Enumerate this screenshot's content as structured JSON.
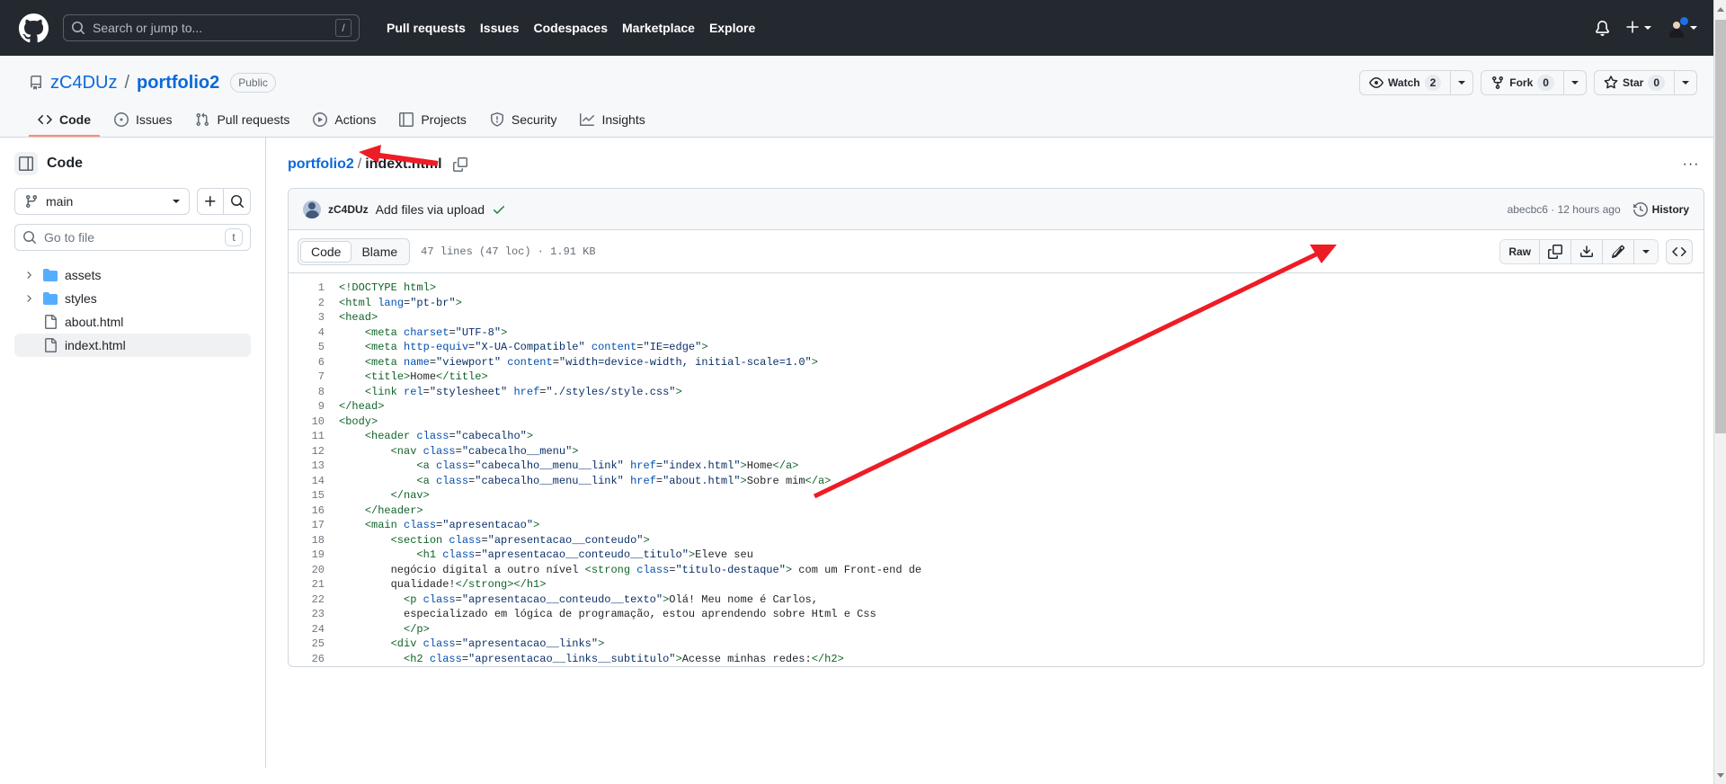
{
  "header": {
    "logo_icon": "github-mark-icon",
    "search": {
      "placeholder": "Search or jump to...",
      "shortcut": "/",
      "icon": "search-icon"
    },
    "nav": [
      {
        "label": "Pull requests"
      },
      {
        "label": "Issues"
      },
      {
        "label": "Codespaces"
      },
      {
        "label": "Marketplace"
      },
      {
        "label": "Explore"
      }
    ],
    "notifications_icon": "bell-icon",
    "create_new_icon": "plus-icon",
    "account_icon": "avatar-icon"
  },
  "repo": {
    "icon": "repo-icon",
    "owner": "zC4DUz",
    "separator": "/",
    "name": "portfolio2",
    "visibility": "Public",
    "actions": [
      {
        "name": "watch",
        "icon": "eye-icon",
        "label": "Watch",
        "count": "2"
      },
      {
        "name": "fork",
        "icon": "fork-icon",
        "label": "Fork",
        "count": "0"
      },
      {
        "name": "star",
        "icon": "star-icon",
        "label": "Star",
        "count": "0"
      }
    ],
    "tabs": [
      {
        "label": "Code",
        "icon": "code-icon",
        "active": true
      },
      {
        "label": "Issues",
        "icon": "issue-opened-icon",
        "active": false
      },
      {
        "label": "Pull requests",
        "icon": "git-pull-request-icon",
        "active": false
      },
      {
        "label": "Actions",
        "icon": "play-icon",
        "active": false
      },
      {
        "label": "Projects",
        "icon": "table-icon",
        "active": false
      },
      {
        "label": "Security",
        "icon": "shield-icon",
        "active": false
      },
      {
        "label": "Insights",
        "icon": "graph-icon",
        "active": false
      }
    ]
  },
  "sidebar": {
    "title": "Code",
    "toggle_icon": "sidebar-collapse-icon",
    "branch": {
      "icon": "git-branch-icon",
      "name": "main"
    },
    "add_file_icon": "plus-icon",
    "search_icon": "search-icon",
    "file_filter": {
      "placeholder": "Go to file",
      "value": "",
      "icon": "search-icon",
      "shortcut": "t"
    },
    "tree": [
      {
        "type": "folder",
        "label": "assets",
        "expanded": false,
        "selected": false
      },
      {
        "type": "folder",
        "label": "styles",
        "expanded": false,
        "selected": false
      },
      {
        "type": "file",
        "label": "about.html",
        "selected": false
      },
      {
        "type": "file",
        "label": "indext.html",
        "selected": true
      }
    ]
  },
  "main": {
    "breadcrumb": {
      "repo": "portfolio2",
      "separator": "/",
      "file": "indext.html",
      "copy_icon": "copy-icon"
    },
    "more_options_label": "···",
    "commit": {
      "author": "zC4DUz",
      "message": "Add files via upload",
      "status_icon": "check-icon",
      "hash_and_time": "abecbc6 · 12 hours ago",
      "history_label": "History",
      "history_icon": "history-icon"
    },
    "toolbar": {
      "tabs": [
        {
          "label": "Code",
          "active": true
        },
        {
          "label": "Blame",
          "active": false
        }
      ],
      "file_meta": "47 lines (47 loc) · 1.91 KB",
      "raw_label": "Raw",
      "copy_icon": "copy-icon",
      "download_icon": "download-icon",
      "edit_icon": "pencil-icon",
      "edit_dropdown_icon": "chevron-down-icon",
      "symbols_icon": "code-brackets-icon"
    },
    "code": {
      "language": "html",
      "lines": [
        {
          "n": 1,
          "tokens": [
            {
              "t": "tg",
              "v": "<!DOCTYPE html>"
            }
          ]
        },
        {
          "n": 2,
          "tokens": [
            {
              "t": "tg",
              "v": "<html "
            },
            {
              "t": "at",
              "v": "lang"
            },
            {
              "t": "pu",
              "v": "="
            },
            {
              "t": "st",
              "v": "\"pt-br\""
            },
            {
              "t": "tg",
              "v": ">"
            }
          ]
        },
        {
          "n": 3,
          "tokens": [
            {
              "t": "tg",
              "v": "<head>"
            }
          ]
        },
        {
          "n": 4,
          "tokens": [
            {
              "t": "tx",
              "v": "    "
            },
            {
              "t": "tg",
              "v": "<meta "
            },
            {
              "t": "at",
              "v": "charset"
            },
            {
              "t": "pu",
              "v": "="
            },
            {
              "t": "st",
              "v": "\"UTF-8\""
            },
            {
              "t": "tg",
              "v": ">"
            }
          ]
        },
        {
          "n": 5,
          "tokens": [
            {
              "t": "tx",
              "v": "    "
            },
            {
              "t": "tg",
              "v": "<meta "
            },
            {
              "t": "at",
              "v": "http-equiv"
            },
            {
              "t": "pu",
              "v": "="
            },
            {
              "t": "st",
              "v": "\"X-UA-Compatible\""
            },
            {
              "t": "tx",
              "v": " "
            },
            {
              "t": "at",
              "v": "content"
            },
            {
              "t": "pu",
              "v": "="
            },
            {
              "t": "st",
              "v": "\"IE=edge\""
            },
            {
              "t": "tg",
              "v": ">"
            }
          ]
        },
        {
          "n": 6,
          "tokens": [
            {
              "t": "tx",
              "v": "    "
            },
            {
              "t": "tg",
              "v": "<meta "
            },
            {
              "t": "at",
              "v": "name"
            },
            {
              "t": "pu",
              "v": "="
            },
            {
              "t": "st",
              "v": "\"viewport\""
            },
            {
              "t": "tx",
              "v": " "
            },
            {
              "t": "at",
              "v": "content"
            },
            {
              "t": "pu",
              "v": "="
            },
            {
              "t": "st",
              "v": "\"width=device-width, initial-scale=1.0\""
            },
            {
              "t": "tg",
              "v": ">"
            }
          ]
        },
        {
          "n": 7,
          "tokens": [
            {
              "t": "tx",
              "v": "    "
            },
            {
              "t": "tg",
              "v": "<title>"
            },
            {
              "t": "tx",
              "v": "Home"
            },
            {
              "t": "tg",
              "v": "</title>"
            }
          ]
        },
        {
          "n": 8,
          "tokens": [
            {
              "t": "tx",
              "v": "    "
            },
            {
              "t": "tg",
              "v": "<link "
            },
            {
              "t": "at",
              "v": "rel"
            },
            {
              "t": "pu",
              "v": "="
            },
            {
              "t": "st",
              "v": "\"stylesheet\""
            },
            {
              "t": "tx",
              "v": " "
            },
            {
              "t": "at",
              "v": "href"
            },
            {
              "t": "pu",
              "v": "="
            },
            {
              "t": "st",
              "v": "\"./styles/style.css\""
            },
            {
              "t": "tg",
              "v": ">"
            }
          ]
        },
        {
          "n": 9,
          "tokens": [
            {
              "t": "tg",
              "v": "</head>"
            }
          ]
        },
        {
          "n": 10,
          "tokens": [
            {
              "t": "tg",
              "v": "<body>"
            }
          ]
        },
        {
          "n": 11,
          "tokens": [
            {
              "t": "tx",
              "v": "    "
            },
            {
              "t": "tg",
              "v": "<header "
            },
            {
              "t": "at",
              "v": "class"
            },
            {
              "t": "pu",
              "v": "="
            },
            {
              "t": "st",
              "v": "\"cabecalho\""
            },
            {
              "t": "tg",
              "v": ">"
            }
          ]
        },
        {
          "n": 12,
          "tokens": [
            {
              "t": "tx",
              "v": "        "
            },
            {
              "t": "tg",
              "v": "<nav "
            },
            {
              "t": "at",
              "v": "class"
            },
            {
              "t": "pu",
              "v": "="
            },
            {
              "t": "st",
              "v": "\"cabecalho__menu\""
            },
            {
              "t": "tg",
              "v": ">"
            }
          ]
        },
        {
          "n": 13,
          "tokens": [
            {
              "t": "tx",
              "v": "            "
            },
            {
              "t": "tg",
              "v": "<a "
            },
            {
              "t": "at",
              "v": "class"
            },
            {
              "t": "pu",
              "v": "="
            },
            {
              "t": "st",
              "v": "\"cabecalho__menu__link\""
            },
            {
              "t": "tx",
              "v": " "
            },
            {
              "t": "at",
              "v": "href"
            },
            {
              "t": "pu",
              "v": "="
            },
            {
              "t": "st",
              "v": "\"index.html\""
            },
            {
              "t": "tg",
              "v": ">"
            },
            {
              "t": "tx",
              "v": "Home"
            },
            {
              "t": "tg",
              "v": "</a>"
            }
          ]
        },
        {
          "n": 14,
          "tokens": [
            {
              "t": "tx",
              "v": "            "
            },
            {
              "t": "tg",
              "v": "<a "
            },
            {
              "t": "at",
              "v": "class"
            },
            {
              "t": "pu",
              "v": "="
            },
            {
              "t": "st",
              "v": "\"cabecalho__menu__link\""
            },
            {
              "t": "tx",
              "v": " "
            },
            {
              "t": "at",
              "v": "href"
            },
            {
              "t": "pu",
              "v": "="
            },
            {
              "t": "st",
              "v": "\"about.html\""
            },
            {
              "t": "tg",
              "v": ">"
            },
            {
              "t": "tx",
              "v": "Sobre mim"
            },
            {
              "t": "tg",
              "v": "</a>"
            }
          ]
        },
        {
          "n": 15,
          "tokens": [
            {
              "t": "tx",
              "v": "        "
            },
            {
              "t": "tg",
              "v": "</nav>"
            }
          ]
        },
        {
          "n": 16,
          "tokens": [
            {
              "t": "tx",
              "v": "    "
            },
            {
              "t": "tg",
              "v": "</header>"
            }
          ]
        },
        {
          "n": 17,
          "tokens": [
            {
              "t": "tx",
              "v": "    "
            },
            {
              "t": "tg",
              "v": "<main "
            },
            {
              "t": "at",
              "v": "class"
            },
            {
              "t": "pu",
              "v": "="
            },
            {
              "t": "st",
              "v": "\"apresentacao\""
            },
            {
              "t": "tg",
              "v": ">"
            }
          ]
        },
        {
          "n": 18,
          "tokens": [
            {
              "t": "tx",
              "v": "        "
            },
            {
              "t": "tg",
              "v": "<section "
            },
            {
              "t": "at",
              "v": "class"
            },
            {
              "t": "pu",
              "v": "="
            },
            {
              "t": "st",
              "v": "\"apresentacao__conteudo\""
            },
            {
              "t": "tg",
              "v": ">"
            }
          ]
        },
        {
          "n": 19,
          "tokens": [
            {
              "t": "tx",
              "v": "            "
            },
            {
              "t": "tg",
              "v": "<h1 "
            },
            {
              "t": "at",
              "v": "class"
            },
            {
              "t": "pu",
              "v": "="
            },
            {
              "t": "st",
              "v": "\"apresentacao__conteudo__titulo\""
            },
            {
              "t": "tg",
              "v": ">"
            },
            {
              "t": "tx",
              "v": "Eleve seu"
            }
          ]
        },
        {
          "n": 20,
          "tokens": [
            {
              "t": "tx",
              "v": "        negócio digital a outro nível "
            },
            {
              "t": "tg",
              "v": "<strong "
            },
            {
              "t": "at",
              "v": "class"
            },
            {
              "t": "pu",
              "v": "="
            },
            {
              "t": "st",
              "v": "\"titulo-destaque\""
            },
            {
              "t": "tg",
              "v": ">"
            },
            {
              "t": "tx",
              "v": " com um Front-end de"
            }
          ]
        },
        {
          "n": 21,
          "tokens": [
            {
              "t": "tx",
              "v": "        qualidade!"
            },
            {
              "t": "tg",
              "v": "</strong></h1>"
            }
          ]
        },
        {
          "n": 22,
          "tokens": [
            {
              "t": "tx",
              "v": "          "
            },
            {
              "t": "tg",
              "v": "<p "
            },
            {
              "t": "at",
              "v": "class"
            },
            {
              "t": "pu",
              "v": "="
            },
            {
              "t": "st",
              "v": "\"apresentacao__conteudo__texto\""
            },
            {
              "t": "tg",
              "v": ">"
            },
            {
              "t": "tx",
              "v": "Olá! Meu nome é Carlos,"
            }
          ]
        },
        {
          "n": 23,
          "tokens": [
            {
              "t": "tx",
              "v": "          especializado em lógica de programação, estou aprendendo sobre Html e Css"
            }
          ]
        },
        {
          "n": 24,
          "tokens": [
            {
              "t": "tx",
              "v": "          "
            },
            {
              "t": "tg",
              "v": "</p>"
            }
          ]
        },
        {
          "n": 25,
          "tokens": [
            {
              "t": "tx",
              "v": "        "
            },
            {
              "t": "tg",
              "v": "<div "
            },
            {
              "t": "at",
              "v": "class"
            },
            {
              "t": "pu",
              "v": "="
            },
            {
              "t": "st",
              "v": "\"apresentacao__links\""
            },
            {
              "t": "tg",
              "v": ">"
            }
          ]
        },
        {
          "n": 26,
          "tokens": [
            {
              "t": "tx",
              "v": "          "
            },
            {
              "t": "tg",
              "v": "<h2 "
            },
            {
              "t": "at",
              "v": "class"
            },
            {
              "t": "pu",
              "v": "="
            },
            {
              "t": "st",
              "v": "\"apresentacao__links__subtitulo\""
            },
            {
              "t": "tg",
              "v": ">"
            },
            {
              "t": "tx",
              "v": "Acesse minhas redes:"
            },
            {
              "t": "tg",
              "v": "</h2>"
            }
          ]
        }
      ]
    }
  },
  "colors": {
    "header_bg": "#24292f",
    "accent_link": "#0969da",
    "active_tab_underline": "#fd8c73",
    "annotation_red": "#ee1c25",
    "folder_blue": "#54aeff",
    "tag_green": "#116329",
    "attr_blue": "#0550ae",
    "string_navy": "#0a3069"
  }
}
